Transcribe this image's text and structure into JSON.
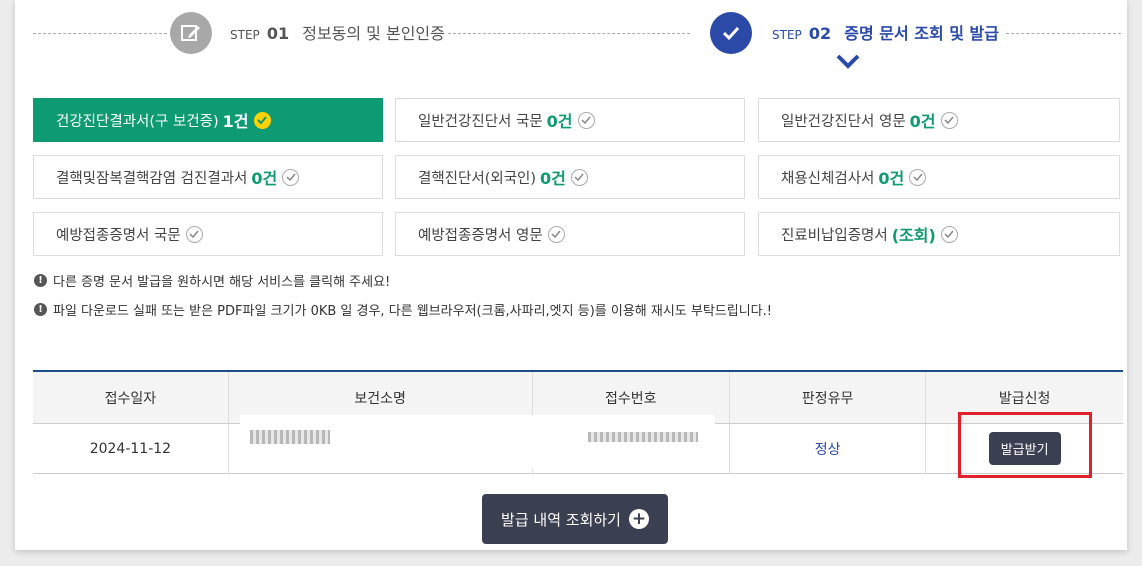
{
  "steps": [
    {
      "prefix": "STEP",
      "number": "01",
      "label": "정보동의 및 본인인증"
    },
    {
      "prefix": "STEP",
      "number": "02",
      "label": "증명 문서 조회 및 발급"
    }
  ],
  "documents": [
    {
      "label": "건강진단결과서(구 보건증)",
      "count": "1건",
      "active": true
    },
    {
      "label": "일반건강진단서 국문",
      "count": "0건"
    },
    {
      "label": "일반건강진단서 영문",
      "count": "0건"
    },
    {
      "label": "결핵및잠복결핵감염 검진결과서",
      "count": "0건"
    },
    {
      "label": "결핵진단서(외국인)",
      "count": "0건"
    },
    {
      "label": "채용신체검사서",
      "count": "0건"
    },
    {
      "label": "예방접종증명서 국문",
      "count": ""
    },
    {
      "label": "예방접종증명서 영문",
      "count": ""
    },
    {
      "label": "진료비납입증명서",
      "count": "(조회)"
    }
  ],
  "notices": [
    "다른 증명 문서 발급을 원하시면 해당 서비스를 클릭해 주세요!",
    "파일 다운로드 실패 또는 받은 PDF파일 크기가 0KB 일 경우, 다른 웹브라우저(크롬,사파리,엣지 등)를 이용해 재시도 부탁드립니다.!"
  ],
  "table": {
    "headers": [
      "접수일자",
      "보건소명",
      "접수번호",
      "판정유무",
      "발급신청"
    ],
    "rows": [
      {
        "date": "2024-11-12",
        "center": "",
        "receipt_no": "",
        "verdict": "정상",
        "action": "발급받기"
      }
    ]
  },
  "history_button": "발급 내역 조회하기",
  "colors": {
    "accent_green": "#0e9a73",
    "step_blue": "#2b4aa8",
    "dark_button": "#3b3f52",
    "highlight_red": "#e0202a"
  },
  "icons": {
    "step1": "pencil-icon",
    "step2": "check-icon",
    "plus": "plus-circle-icon"
  }
}
